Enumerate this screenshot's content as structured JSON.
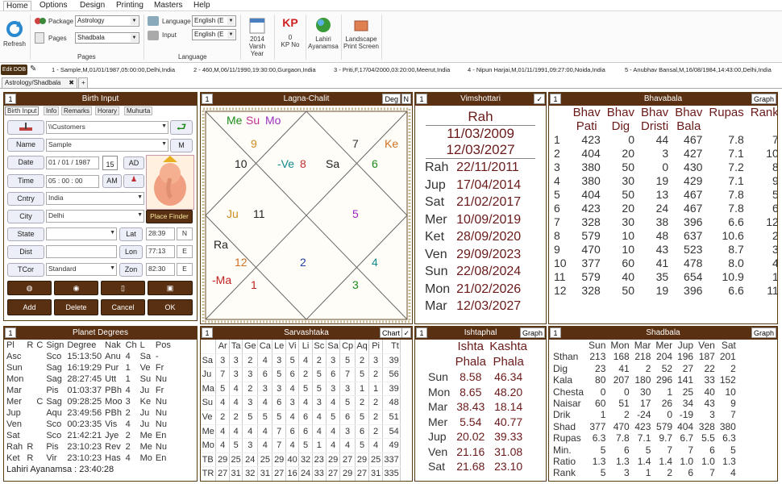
{
  "menu": [
    "Home",
    "Options",
    "Design",
    "Printing",
    "Masters",
    "Help"
  ],
  "ribbon": {
    "refresh": "Refresh",
    "package_label": "Package",
    "package_value": "Astrology",
    "pages_label": "Pages",
    "pages_value": "Shadbala",
    "pages_group": "Pages",
    "language_label": "Language",
    "language_value": "English (E",
    "input_label": "Input",
    "input_value": "English (E",
    "language_group": "Language",
    "year_value": "2014",
    "year_label": "Varsh Year",
    "kp_value": "0",
    "kp_label": "KP No",
    "lahiri_label": "Lahiri",
    "ayanamsa_label": "Ayanamsa",
    "landscape_label": "Landscape",
    "print_label": "Print Screen"
  },
  "recent": {
    "edit_dob": "Edit DOB",
    "items": [
      "1 - Sample,M,01/01/1987,05:00:00,Delhi,India",
      "2 - 460,M,06/11/1990,19:30:00,Gurgaon,India",
      "3 - Priti,F,17/04/2000,03:20:00,Meerut,India",
      "4 - Nipun Harjai,M,01/11/1991,09:27:00,Noida,India",
      "5 - Anubhav Bansal,M,16/08/1984,14:43:00,Delhi,India"
    ]
  },
  "doc_tab": "Astrology/Shadbala",
  "birth": {
    "num": "1",
    "title": "Birth Input",
    "tabs": [
      "Birth Input",
      "Info",
      "Remarks",
      "Horary",
      "Muhurta"
    ],
    "folder": "\\\\Customers",
    "name_btn": "Name",
    "name": "Sample",
    "m_btn": "M",
    "date_btn": "Date",
    "date": "01 / 01 / 1987",
    "cal_day": "15",
    "ad": "AD",
    "time_btn": "Time",
    "time": "05 : 00 : 00",
    "am": "AM",
    "cntry_btn": "Cntry",
    "country": "India",
    "city_btn": "City",
    "city": "Delhi",
    "place_finder": "Place Finder",
    "state_btn": "State",
    "lat_btn": "Lat",
    "lat": "28:39",
    "lat_dir": "N",
    "dist_btn": "Dist",
    "lon_btn": "Lon",
    "lon": "77:13",
    "lon_dir": "E",
    "tcor_btn": "TCor",
    "tcor": "Standard",
    "zon_btn": "Zon",
    "zon": "82:30",
    "zon_dir": "E",
    "add": "Add",
    "delete": "Delete",
    "cancel": "Cancel",
    "ok": "OK"
  },
  "lagna": {
    "num": "1",
    "title": "Lagna-Chalit",
    "deg": "Deg",
    "n": "N",
    "labels": [
      {
        "t": "Me",
        "c": "#1a8a1a"
      },
      {
        "t": "Su",
        "c": "#c03090"
      },
      {
        "t": "Mo",
        "c": "#9a30c0"
      },
      {
        "t": "9",
        "c": "#d08a20"
      },
      {
        "t": "7",
        "c": "#333"
      },
      {
        "t": "Ke",
        "c": "#d07020"
      },
      {
        "t": "10",
        "c": "#222"
      },
      {
        "t": "-Ve",
        "c": "#108a8a"
      },
      {
        "t": "8",
        "c": "#c03030"
      },
      {
        "t": "Sa",
        "c": "#222"
      },
      {
        "t": "6",
        "c": "#1a8a1a"
      },
      {
        "t": "Ju",
        "c": "#d08a20"
      },
      {
        "t": "11",
        "c": "#222"
      },
      {
        "t": "5",
        "c": "#a020c0"
      },
      {
        "t": "Ra",
        "c": "#222"
      },
      {
        "t": "12",
        "c": "#d07020"
      },
      {
        "t": "2",
        "c": "#2040a0"
      },
      {
        "t": "4",
        "c": "#108a8a"
      },
      {
        "t": "-Ma",
        "c": "#c02020"
      },
      {
        "t": "1",
        "c": "#c02020"
      },
      {
        "t": "3",
        "c": "#1a8a1a"
      }
    ]
  },
  "vim": {
    "num": "1",
    "title": "Vimshottari",
    "check": "✓",
    "head": "Rah",
    "from": "11/03/2009",
    "to": "12/03/2027",
    "rows": [
      [
        "Rah",
        "22/11/2011"
      ],
      [
        "Jup",
        "17/04/2014"
      ],
      [
        "Sat",
        "21/02/2017"
      ],
      [
        "Mer",
        "10/09/2019"
      ],
      [
        "Ket",
        "28/09/2020"
      ],
      [
        "Ven",
        "29/09/2023"
      ],
      [
        "Sun",
        "22/08/2024"
      ],
      [
        "Mon",
        "21/02/2026"
      ],
      [
        "Mar",
        "12/03/2027"
      ]
    ]
  },
  "bhav": {
    "num": "1",
    "title": "Bhavabala",
    "graph": "Graph",
    "h1": [
      "Bhav",
      "Bhav",
      "Bhav",
      "Bhav",
      "Rupas",
      "Rank"
    ],
    "h2": [
      "Pati",
      "Dig",
      "Dristi",
      "Bala",
      "",
      ""
    ],
    "rows": [
      [
        "1",
        "423",
        "0",
        "44",
        "467",
        "7.8",
        "7"
      ],
      [
        "2",
        "404",
        "20",
        "3",
        "427",
        "7.1",
        "10"
      ],
      [
        "3",
        "380",
        "50",
        "0",
        "430",
        "7.2",
        "8"
      ],
      [
        "4",
        "380",
        "30",
        "19",
        "429",
        "7.1",
        "9"
      ],
      [
        "5",
        "404",
        "50",
        "13",
        "467",
        "7.8",
        "5"
      ],
      [
        "6",
        "423",
        "20",
        "24",
        "467",
        "7.8",
        "6"
      ],
      [
        "7",
        "328",
        "30",
        "38",
        "396",
        "6.6",
        "12"
      ],
      [
        "8",
        "579",
        "10",
        "48",
        "637",
        "10.6",
        "2"
      ],
      [
        "9",
        "470",
        "10",
        "43",
        "523",
        "8.7",
        "3"
      ],
      [
        "10",
        "377",
        "60",
        "41",
        "478",
        "8.0",
        "4"
      ],
      [
        "11",
        "579",
        "40",
        "35",
        "654",
        "10.9",
        "1"
      ],
      [
        "12",
        "328",
        "50",
        "19",
        "396",
        "6.6",
        "11"
      ]
    ]
  },
  "planets": {
    "num": "1",
    "title": "Planet Degrees",
    "head": [
      "Pl",
      "R",
      "C",
      "Sign",
      "Degree",
      "Nak",
      "Ch",
      "L",
      "Pos"
    ],
    "rows": [
      [
        "Asc",
        "",
        "",
        "Sco",
        "15:13:50",
        "Anu",
        "4",
        "Sa",
        "-"
      ],
      [
        "Sun",
        "",
        "",
        "Sag",
        "16:19:29",
        "Pur",
        "1",
        "Ve",
        "Fr"
      ],
      [
        "Mon",
        "",
        "",
        "Sag",
        "28:27:45",
        "Utt",
        "1",
        "Su",
        "Nu"
      ],
      [
        "Mar",
        "",
        "",
        "Pis",
        "01:03:37",
        "PBh",
        "4",
        "Ju",
        "Fr"
      ],
      [
        "Mer",
        "",
        "C",
        "Sag",
        "09:28:25",
        "Moo",
        "3",
        "Ke",
        "Nu"
      ],
      [
        "Jup",
        "",
        "",
        "Aqu",
        "23:49:56",
        "PBh",
        "2",
        "Ju",
        "Nu"
      ],
      [
        "Ven",
        "",
        "",
        "Sco",
        "00:23:35",
        "Vis",
        "4",
        "Ju",
        "Nu"
      ],
      [
        "Sat",
        "",
        "",
        "Sco",
        "21:42:21",
        "Jye",
        "2",
        "Me",
        "En"
      ],
      [
        "Rah",
        "R",
        "",
        "Pis",
        "23:10:23",
        "Rev",
        "2",
        "Me",
        "Nu"
      ],
      [
        "Ket",
        "R",
        "",
        "Vir",
        "23:10:23",
        "Has",
        "4",
        "Mo",
        "En"
      ]
    ],
    "footer": "Lahiri Ayanamsa : 23:40:28"
  },
  "sarva": {
    "num": "1",
    "title": "Sarvashtaka",
    "chart": "Chart",
    "check": "✓",
    "head": [
      "",
      "Ar",
      "Ta",
      "Ge",
      "Ca",
      "Le",
      "Vi",
      "Li",
      "Sc",
      "Sa",
      "Cp",
      "Aq",
      "Pi",
      "Tt"
    ],
    "rows": [
      [
        "Sa",
        "3",
        "3",
        "2",
        "4",
        "3",
        "5",
        "4",
        "2",
        "3",
        "5",
        "2",
        "3",
        "39"
      ],
      [
        "Ju",
        "7",
        "3",
        "3",
        "6",
        "5",
        "6",
        "2",
        "5",
        "6",
        "7",
        "5",
        "2",
        "56"
      ],
      [
        "Ma",
        "5",
        "4",
        "2",
        "3",
        "3",
        "4",
        "5",
        "5",
        "3",
        "3",
        "1",
        "1",
        "39"
      ],
      [
        "Su",
        "4",
        "4",
        "3",
        "4",
        "6",
        "3",
        "4",
        "3",
        "4",
        "5",
        "2",
        "2",
        "48"
      ],
      [
        "Ve",
        "2",
        "2",
        "5",
        "5",
        "5",
        "4",
        "6",
        "4",
        "5",
        "6",
        "5",
        "2",
        "51"
      ],
      [
        "Me",
        "4",
        "4",
        "4",
        "4",
        "7",
        "6",
        "6",
        "4",
        "4",
        "3",
        "6",
        "2",
        "54"
      ],
      [
        "Mo",
        "4",
        "5",
        "3",
        "4",
        "7",
        "4",
        "5",
        "1",
        "4",
        "4",
        "5",
        "4",
        "49"
      ],
      [
        "TB",
        "29",
        "25",
        "24",
        "25",
        "29",
        "40",
        "32",
        "23",
        "29",
        "27",
        "29",
        "25",
        "337"
      ],
      [
        "TR",
        "27",
        "31",
        "32",
        "31",
        "27",
        "16",
        "24",
        "33",
        "27",
        "29",
        "27",
        "31",
        "335"
      ]
    ]
  },
  "ishta": {
    "num": "1",
    "title": "Ishtaphal",
    "graph": "Graph",
    "h1": [
      "",
      "Ishta",
      "Kashta"
    ],
    "h2": [
      "",
      "Phala",
      "Phala"
    ],
    "rows": [
      [
        "Sun",
        "8.58",
        "46.34"
      ],
      [
        "Mon",
        "8.65",
        "48.20"
      ],
      [
        "Mar",
        "38.43",
        "18.14"
      ],
      [
        "Mer",
        "5.54",
        "40.77"
      ],
      [
        "Jup",
        "20.02",
        "39.33"
      ],
      [
        "Ven",
        "21.16",
        "31.08"
      ],
      [
        "Sat",
        "21.68",
        "23.10"
      ]
    ]
  },
  "shad": {
    "num": "1",
    "title": "Shadbala",
    "graph": "Graph",
    "head": [
      "",
      "Sun",
      "Mon",
      "Mar",
      "Mer",
      "Jup",
      "Ven",
      "Sat"
    ],
    "rows": [
      [
        "Sthan",
        "213",
        "168",
        "218",
        "204",
        "196",
        "187",
        "201"
      ],
      [
        "Dig",
        "23",
        "41",
        "2",
        "52",
        "27",
        "22",
        "2"
      ],
      [
        "Kala",
        "80",
        "207",
        "180",
        "296",
        "141",
        "33",
        "152"
      ],
      [
        "Chesta",
        "0",
        "0",
        "30",
        "1",
        "25",
        "40",
        "10"
      ],
      [
        "Naisar",
        "60",
        "51",
        "17",
        "26",
        "34",
        "43",
        "9"
      ],
      [
        "Drik",
        "1",
        "2",
        "-24",
        "0",
        "-19",
        "3",
        "7"
      ],
      [
        "Shad",
        "377",
        "470",
        "423",
        "579",
        "404",
        "328",
        "380"
      ],
      [
        "Rupas",
        "6.3",
        "7.8",
        "7.1",
        "9.7",
        "6.7",
        "5.5",
        "6.3"
      ],
      [
        "Min.",
        "5",
        "6",
        "5",
        "7",
        "7",
        "6",
        "5"
      ],
      [
        "Ratio",
        "1.3",
        "1.3",
        "1.4",
        "1.4",
        "1.0",
        "1.0",
        "1.3"
      ],
      [
        "Rank",
        "5",
        "3",
        "1",
        "2",
        "6",
        "7",
        "4"
      ]
    ]
  }
}
